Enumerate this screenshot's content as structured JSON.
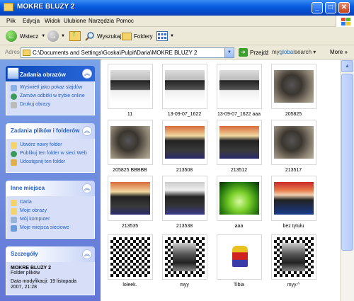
{
  "window": {
    "title": "MOKRE BLUZY 2"
  },
  "menu": [
    "Plik",
    "Edycja",
    "Widok",
    "Ulubione",
    "Narzędzia",
    "Pomoc"
  ],
  "toolbar": {
    "back": "Wstecz",
    "search": "Wyszukaj",
    "folders": "Foldery"
  },
  "address": {
    "label": "Adres",
    "value": "C:\\Documents and Settings\\Goska\\Pulpit\\Daria\\MOKRE BLUZY 2",
    "go": "Przejdź",
    "toolbar_brand_prefix": "my",
    "toolbar_brand_main": "global",
    "toolbar_brand_suffix": "search",
    "more": "More"
  },
  "sidebar": {
    "image_tasks": {
      "title": "Zadania obrazów",
      "items": [
        "Wyświetl jako pokaz slajdów",
        "Zamów odbitki w trybie online",
        "Drukuj obrazy"
      ]
    },
    "file_tasks": {
      "title": "Zadania plików i folderów",
      "items": [
        "Utwórz nowy folder",
        "Publikuj ten folder w sieci Web",
        "Udostępnij ten folder"
      ]
    },
    "other_places": {
      "title": "Inne miejsca",
      "items": [
        "Daria",
        "Moje obrazy",
        "Mój komputer",
        "Moje miejsca sieciowe"
      ]
    },
    "details": {
      "title": "Szczegóły",
      "name": "MOKRE BLUZY 2",
      "type": "Folder plików",
      "modified": "Data modyfikacji: 19 listopada 2007, 21:28"
    }
  },
  "files": [
    {
      "name": "11",
      "style": "bw"
    },
    {
      "name": "13-09-07_1622",
      "style": "bw"
    },
    {
      "name": "13-09-07_1622 aaa",
      "style": "bw"
    },
    {
      "name": "205825",
      "style": "sepia"
    },
    {
      "name": "205825 BBBBB",
      "style": "sepia"
    },
    {
      "name": "213508",
      "style": "color"
    },
    {
      "name": "213512",
      "style": "color"
    },
    {
      "name": "213517",
      "style": "sepia"
    },
    {
      "name": "213535",
      "style": "color"
    },
    {
      "name": "213538",
      "style": "bwcolor"
    },
    {
      "name": "aaa",
      "style": "green"
    },
    {
      "name": "bez tytułu",
      "style": "colorred"
    },
    {
      "name": "loleek.",
      "style": "checker"
    },
    {
      "name": "myy",
      "style": "checkerphoto"
    },
    {
      "name": "Tibia",
      "style": "tibia"
    },
    {
      "name": "myy.^",
      "style": "checkerphoto"
    }
  ],
  "colors": {
    "title_blue": "#0a5ee0",
    "sidebar_blue": "#6375d6",
    "link_blue": "#215dc6"
  }
}
